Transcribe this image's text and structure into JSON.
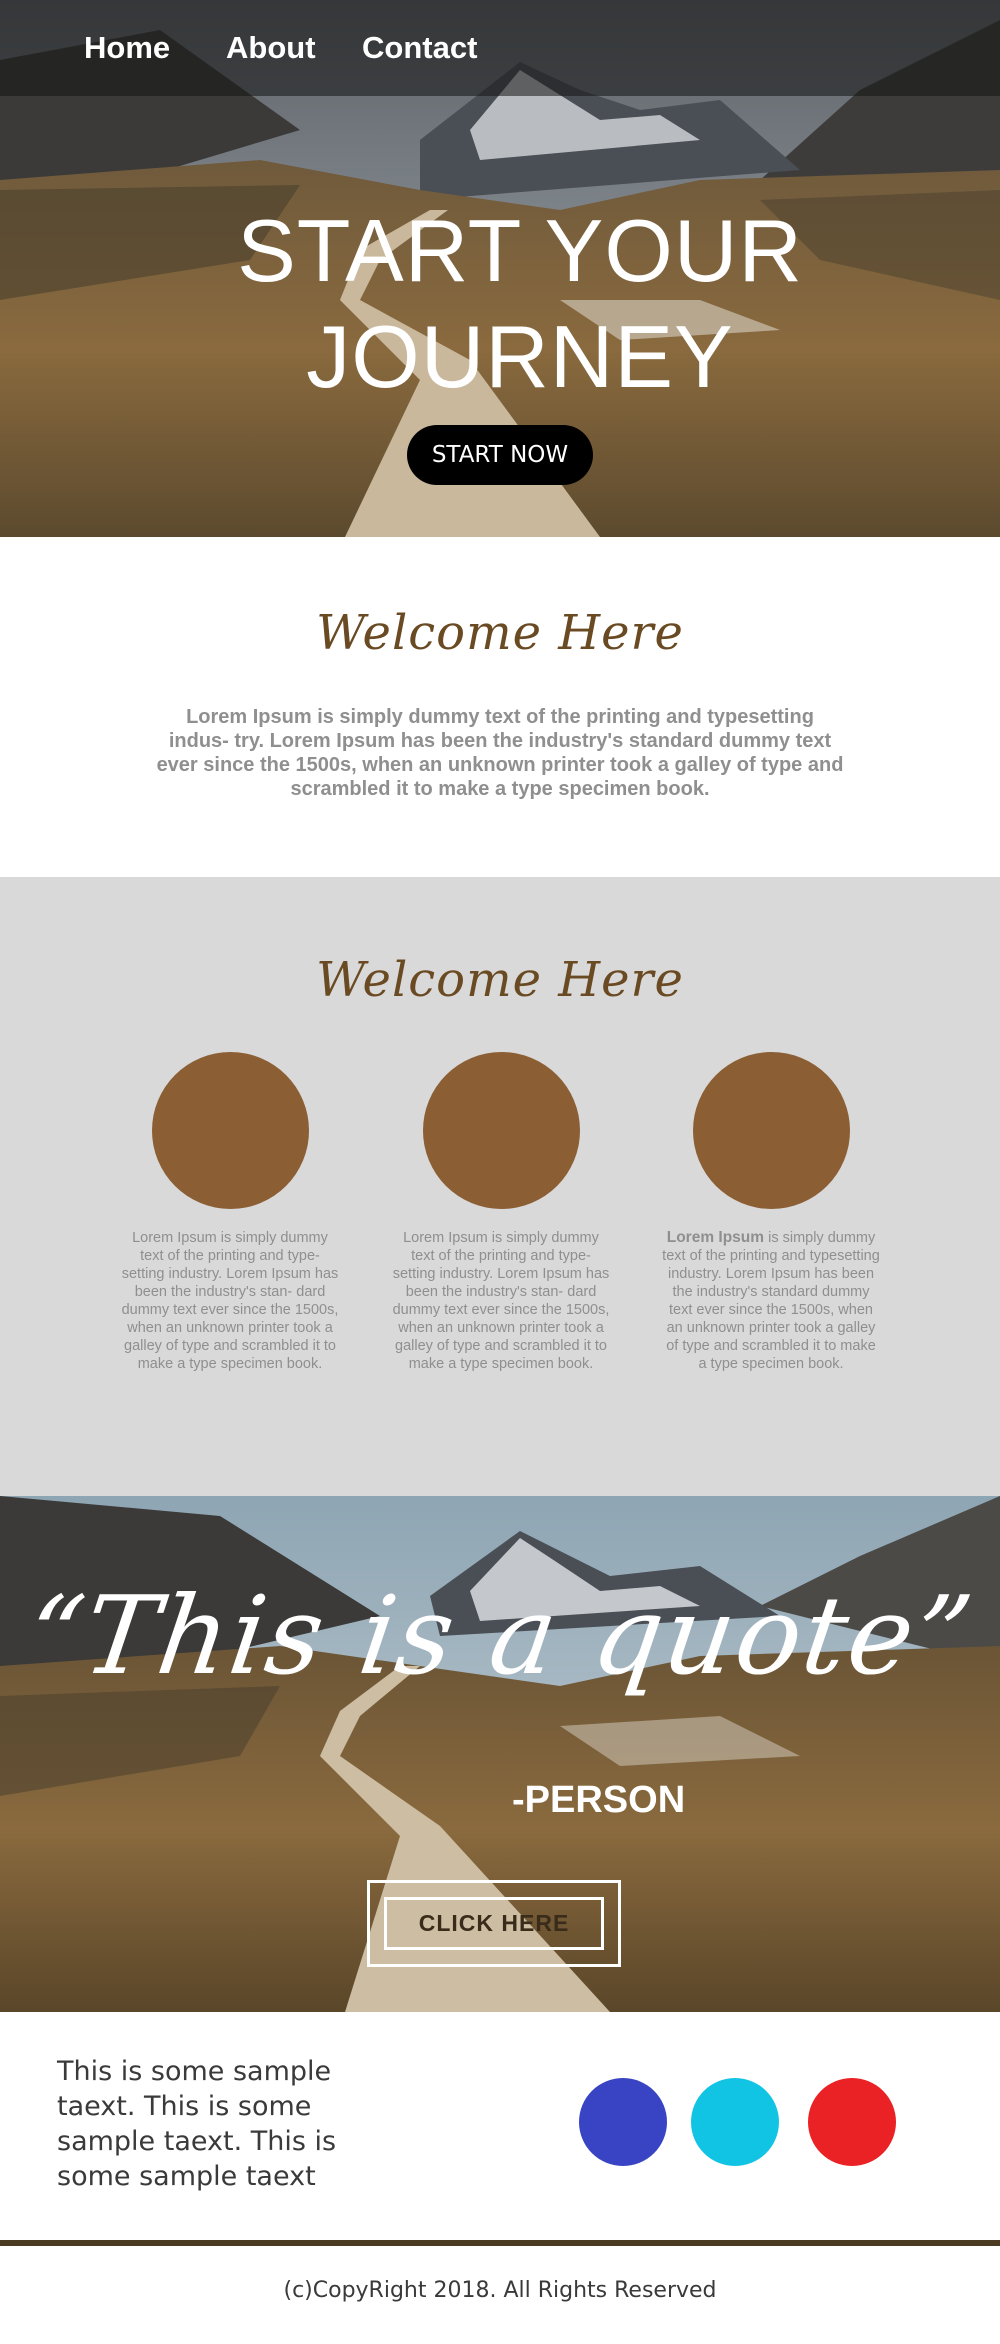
{
  "nav": {
    "home": "Home",
    "about": "About",
    "contact": "Contact"
  },
  "hero": {
    "title_line1": "START YOUR",
    "title_line2": "JOURNEY",
    "button": "START NOW"
  },
  "welcome": {
    "title": "Welcome Here",
    "text": "Lorem Ipsum is simply dummy text of the printing and typesetting indus- try. Lorem Ipsum has been the industry's standard dummy text ever since the 1500s, when an unknown printer took a galley of type and scrambled it to make a type specimen book."
  },
  "features": {
    "title": "Welcome Here",
    "items": [
      {
        "text": "Lorem Ipsum is simply dummy text of the printing and type- setting industry. Lorem Ipsum has been the industry's stan- dard dummy text ever since the 1500s, when an unknown printer took a galley of type and scrambled it to make a type specimen book."
      },
      {
        "text": "Lorem Ipsum is simply dummy text of the printing and type- setting industry. Lorem Ipsum has been the industry's stan- dard dummy text ever since the 1500s, when an unknown printer took a galley of type and scrambled it to make a type specimen book."
      },
      {
        "bold": "Lorem Ipsum",
        "text": " is simply dummy text of the printing and typesetting industry. Lorem Ipsum has been the industry's standard dummy text ever since the 1500s, when an unknown printer took a galley of type and scrambled it to make a type specimen book."
      }
    ],
    "circle_color": "#8b5e34"
  },
  "quote": {
    "text": "“This is a quote”",
    "person": "-PERSON",
    "button": "CLICK HERE"
  },
  "footer": {
    "sample_text": "This is some sample taext. This is some sample taext. This is some sample taext",
    "colors": [
      "#3844c3",
      "#12c4e4",
      "#ea2125"
    ],
    "copyright": "(c)CopyRight 2018. All Rights Reserved"
  },
  "theme": {
    "accent_brown": "#6a4a22",
    "divider": "#4a3b22",
    "section_gray": "#d9d9d9"
  }
}
